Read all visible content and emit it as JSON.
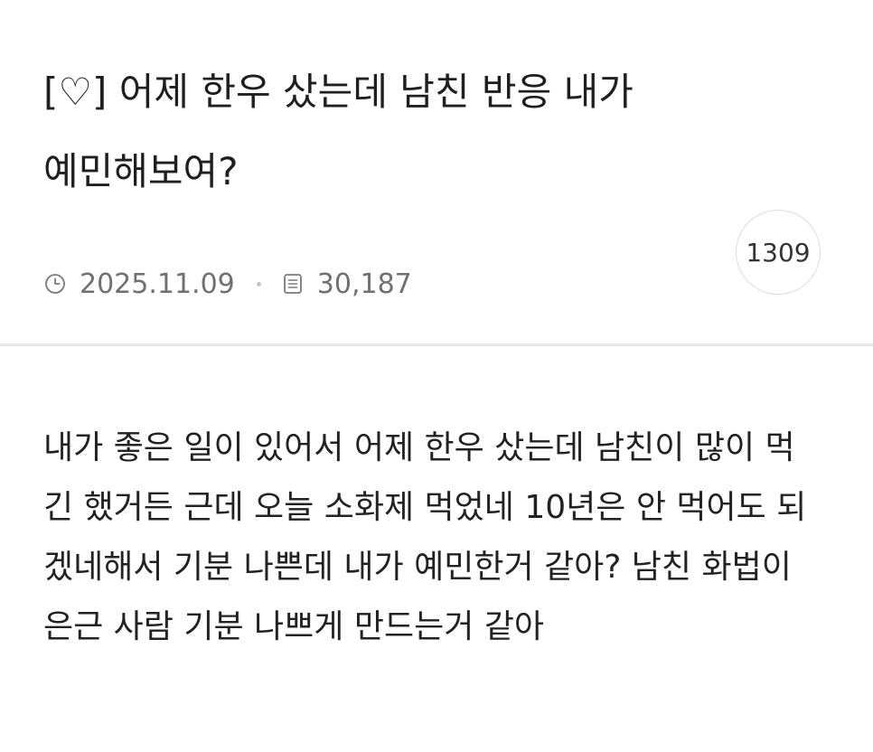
{
  "post": {
    "title": "[♡] 어제 한우 샀는데 남친 반응 내가 예민해보여?",
    "date": "2025.11.09",
    "views": "30,187",
    "comment_count": "1309",
    "body": "내가 좋은 일이 있어서 어제 한우 샀는데 남친이 많이 먹긴 했거든 근데 오늘 소화제 먹었네 10년은 안 먹어도 되겠네해서 기분 나쁜데 내가 예민한거 같아? 남친 화법이 은근 사람 기분 나쁘게 만드는거 같아"
  },
  "icons": {
    "date": "clock-icon",
    "views": "document-icon"
  },
  "colors": {
    "text": "#222222",
    "meta": "#707070",
    "divider": "#e8e8e8",
    "badge_border": "#dcdcdc"
  }
}
